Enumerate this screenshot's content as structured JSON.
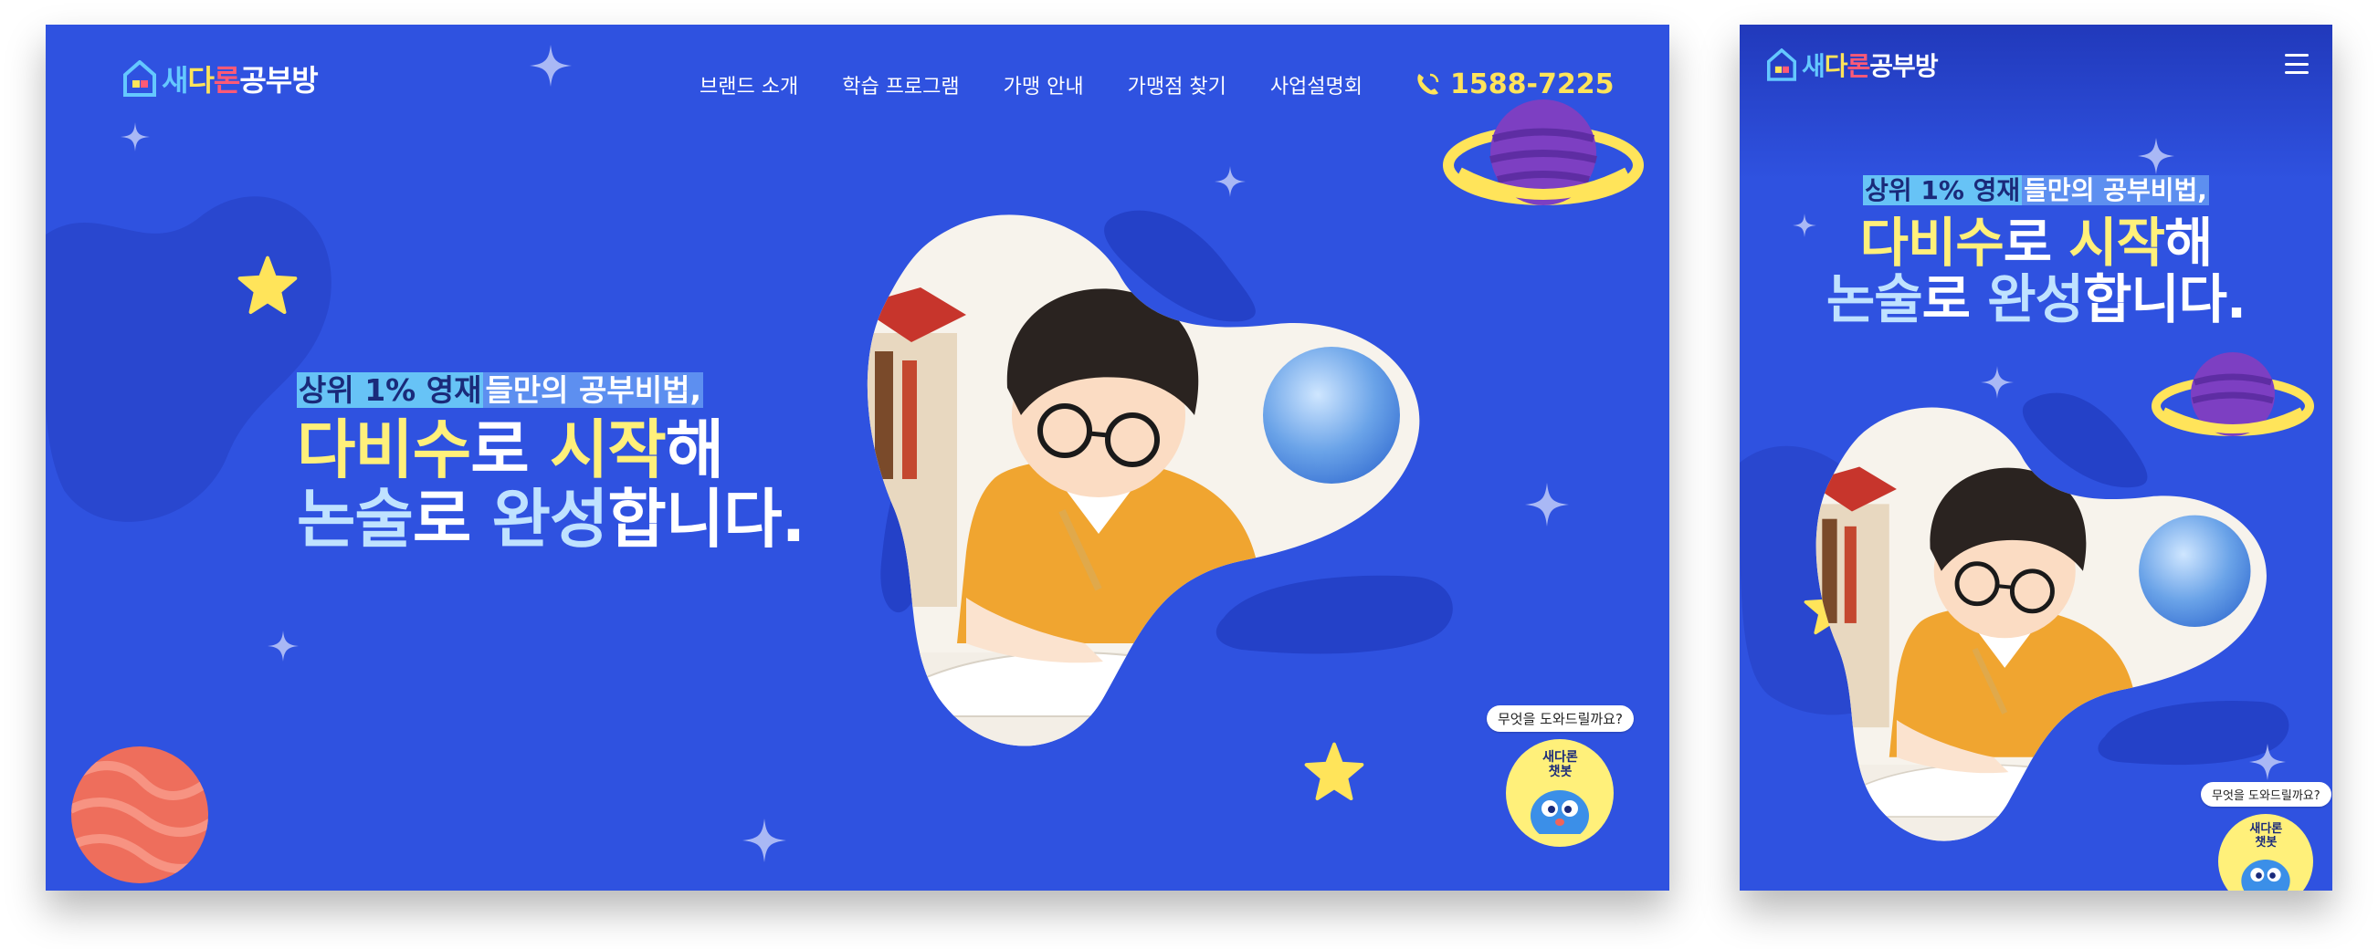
{
  "brand": {
    "logo_parts": [
      "새",
      "다",
      "론",
      "공부방"
    ],
    "logo_alt": "새다론공부방"
  },
  "nav": {
    "items": [
      "브랜드 소개",
      "학습 프로그램",
      "가맹 안내",
      "가맹점 찾기",
      "사업설명회"
    ],
    "phone": "1588-7225"
  },
  "hero": {
    "tagline_highlight": "상위 1% 영재",
    "tagline_rest": "들만의 공부비법,",
    "line1": [
      "다비수",
      "로 ",
      "시작",
      "해"
    ],
    "line2": [
      "논술",
      "로 ",
      "완성",
      "합니다."
    ]
  },
  "chatbot": {
    "bubble": "무엇을 도와드릴까요?",
    "label_line1": "새다론",
    "label_line2": "챗봇"
  },
  "colors": {
    "background": "#2f52e0",
    "accent_yellow": "#fff07a",
    "accent_lightblue": "#bfe2ff",
    "tag_highlight": "#67c3f6"
  },
  "icons": [
    "logo-house-icon",
    "phone-icon",
    "menu-icon",
    "planet-icon",
    "star-icon",
    "sparkle-icon",
    "chatbot-mascot-icon"
  ]
}
